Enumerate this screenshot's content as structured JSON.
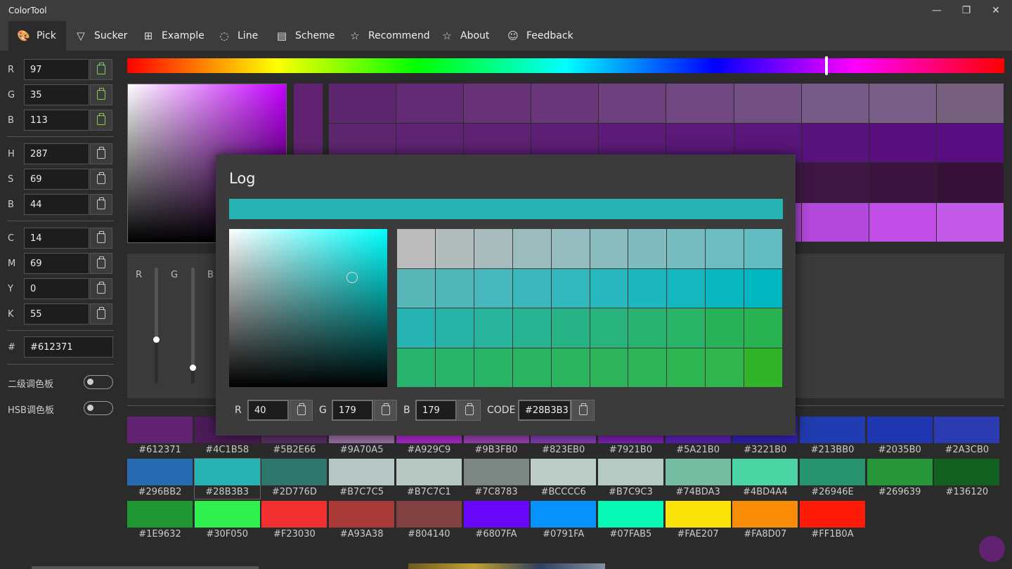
{
  "app": {
    "title": "ColorTool"
  },
  "window_controls": {
    "minimize": "—",
    "restore": "❐",
    "close": "✕"
  },
  "tabs": [
    {
      "label": "Pick",
      "icon": "palette-icon",
      "glyph": "🎨"
    },
    {
      "label": "Sucker",
      "icon": "filter-icon",
      "glyph": "▽"
    },
    {
      "label": "Example",
      "icon": "grid-icon",
      "glyph": "⊞"
    },
    {
      "label": "Line",
      "icon": "dotted-circle-icon",
      "glyph": "◌"
    },
    {
      "label": "Scheme",
      "icon": "clipboard-list-icon",
      "glyph": "▤"
    },
    {
      "label": "Recommend",
      "icon": "star-icon",
      "glyph": "☆"
    },
    {
      "label": "About",
      "icon": "star-icon",
      "glyph": "☆"
    },
    {
      "label": "Feedback",
      "icon": "smiley-icon",
      "glyph": "☺"
    }
  ],
  "fields": {
    "rgb": [
      {
        "label": "R",
        "value": "97"
      },
      {
        "label": "G",
        "value": "35"
      },
      {
        "label": "B",
        "value": "113"
      }
    ],
    "hsb": [
      {
        "label": "H",
        "value": "287"
      },
      {
        "label": "S",
        "value": "69"
      },
      {
        "label": "B",
        "value": "44"
      }
    ],
    "cmyk": [
      {
        "label": "C",
        "value": "14"
      },
      {
        "label": "M",
        "value": "69"
      },
      {
        "label": "Y",
        "value": "0"
      },
      {
        "label": "K",
        "value": "55"
      }
    ],
    "hex": {
      "label": "#",
      "value": "#612371"
    }
  },
  "toggles": [
    {
      "label": "二级调色板",
      "on": false
    },
    {
      "label": "HSB调色板",
      "on": false
    }
  ],
  "hue_position": 0.797,
  "main_swatch_grid": [
    [
      "#5f2670",
      "#632b73",
      "#673276",
      "#6a387a",
      "#6d3f7d",
      "#714781",
      "#735084",
      "#765a88",
      "#795f88",
      "#76607e"
    ],
    [
      "#5f2670",
      "#5e2372",
      "#5e2174",
      "#5d1e76",
      "#5c1b78",
      "#5b1979",
      "#5a167b",
      "#59137d",
      "#58107f",
      "#570e81"
    ],
    [
      "#5f2670",
      "#5a2369",
      "#552163",
      "#501e5c",
      "#4b1c56",
      "#461a50",
      "#42184a",
      "#3e1644",
      "#3a143e",
      "#361238"
    ],
    [
      "#5f2670",
      "#6b2b80",
      "#773090",
      "#8335a0",
      "#8f3aaf",
      "#9b3fbf",
      "#a743cf",
      "#b348dc",
      "#bf4de6",
      "#c45ae8"
    ]
  ],
  "rgb_sliders": {
    "labels": [
      "R",
      "G",
      "B"
    ],
    "values": [
      97,
      35,
      113
    ]
  },
  "swatches": [
    "#612371",
    "#4C1B58",
    "#5B2E66",
    "#9A70A5",
    "#A929C9",
    "#9B3FB0",
    "#823EB0",
    "#7921B0",
    "#5A21B0",
    "#3221B0",
    "#213BB0",
    "#2035B0",
    "#2A3CB0",
    "#296BB2",
    "#28B3B3",
    "#2D776D",
    "#B7C7C5",
    "#B7C7C1",
    "#7C8783",
    "#BCCCC6",
    "#B7C9C3",
    "#74BDA3",
    "#4BD4A4",
    "#26946E",
    "#269639",
    "#136120",
    "#1E9632",
    "#30F050",
    "#F23030",
    "#A93A38",
    "#804140",
    "#6807FA",
    "#0791FA",
    "#07FAB5",
    "#FAE207",
    "#FA8D07",
    "#FF1B0A"
  ],
  "selected_swatch": 14,
  "dialog": {
    "title": "Log",
    "color": "#28B3B3",
    "grid": [
      [
        "#bcbcbc",
        "#b2bcbd",
        "#a8bcbd",
        "#9ebcbe",
        "#94bcbe",
        "#8abcbf",
        "#80bcbf",
        "#76bcc0",
        "#6cbcc0",
        "#62bcc1"
      ],
      [
        "#5ab7b8",
        "#50b7b9",
        "#46b7ba",
        "#3cb7bb",
        "#32b7bc",
        "#28b7bd",
        "#1eb7be",
        "#14b7bf",
        "#0ab7c0",
        "#00b7c1"
      ],
      [
        "#28b3b3",
        "#28b3a8",
        "#28b39d",
        "#28b392",
        "#28b387",
        "#28b37c",
        "#28b371",
        "#28b366",
        "#28b35b",
        "#28b350"
      ],
      [
        "#28b46e",
        "#29b46a",
        "#2ab466",
        "#2bb462",
        "#2cb45e",
        "#2db45a",
        "#2eb456",
        "#2fb452",
        "#30b44e",
        "#31b42a"
      ]
    ],
    "r": {
      "label": "R",
      "value": "40"
    },
    "g": {
      "label": "G",
      "value": "179"
    },
    "b": {
      "label": "B",
      "value": "179"
    },
    "code": {
      "label": "CODE",
      "value": "#28B3B3"
    }
  }
}
